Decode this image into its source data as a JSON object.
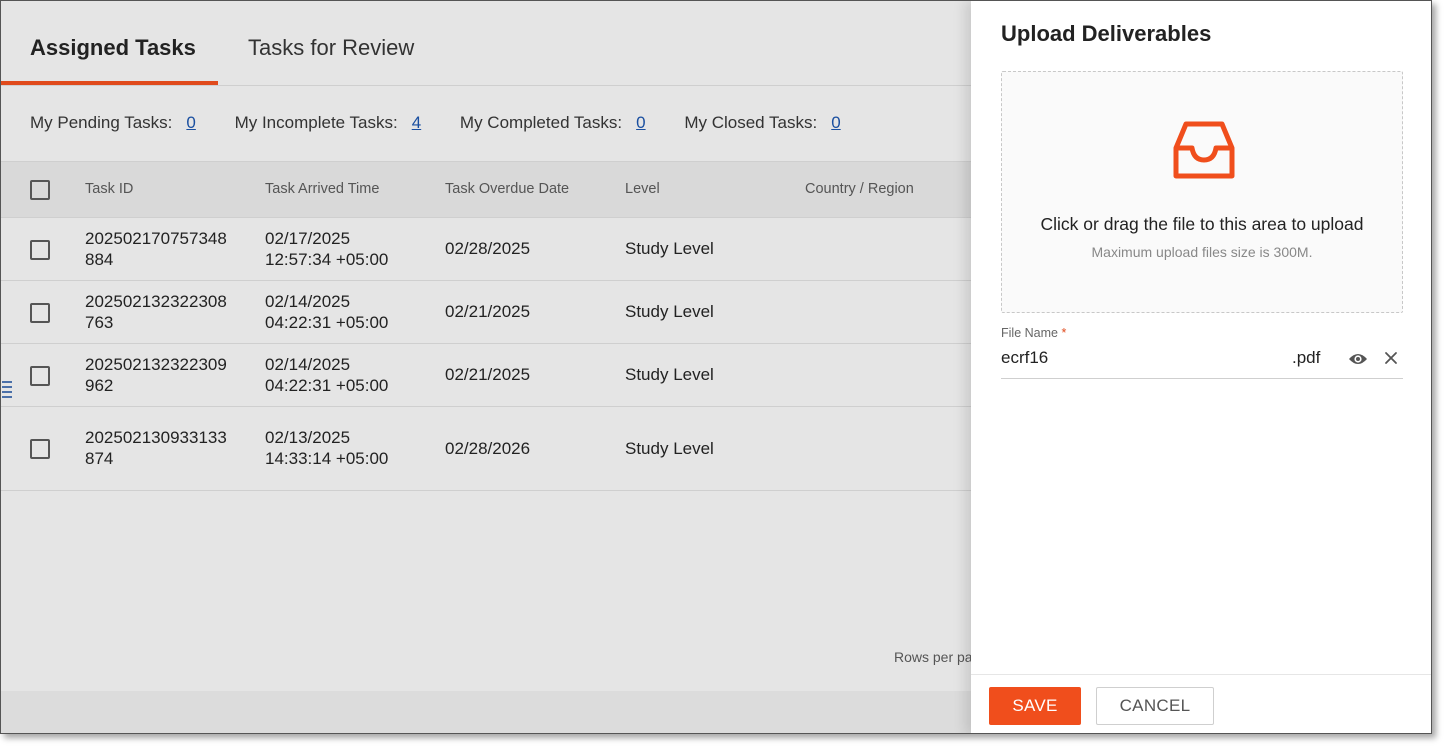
{
  "tabs": [
    {
      "label": "Assigned Tasks",
      "active": true
    },
    {
      "label": "Tasks for Review",
      "active": false
    }
  ],
  "stats": {
    "pending_label": "My Pending Tasks:",
    "pending_value": "0",
    "incomplete_label": "My Incomplete Tasks:",
    "incomplete_value": "4",
    "completed_label": "My Completed Tasks:",
    "completed_value": "0",
    "closed_label": "My Closed Tasks:",
    "closed_value": "0"
  },
  "table": {
    "headers": [
      "Task ID",
      "Task Arrived Time",
      "Task Overdue Date",
      "Level",
      "Country / Region"
    ],
    "rows": [
      {
        "id_line1": "202502170757348",
        "id_line2": "884",
        "arrived_date": "02/17/2025",
        "arrived_time": "12:57:34 +05:00",
        "overdue": "02/28/2025",
        "level": "Study Level"
      },
      {
        "id_line1": "202502132322308",
        "id_line2": "763",
        "arrived_date": "02/14/2025",
        "arrived_time": "04:22:31 +05:00",
        "overdue": "02/21/2025",
        "level": "Study Level"
      },
      {
        "id_line1": "202502132322309",
        "id_line2": "962",
        "arrived_date": "02/14/2025",
        "arrived_time": "04:22:31 +05:00",
        "overdue": "02/21/2025",
        "level": "Study Level"
      },
      {
        "id_line1": "202502130933133",
        "id_line2": "874",
        "arrived_date": "02/13/2025",
        "arrived_time": "14:33:14 +05:00",
        "overdue": "02/28/2026",
        "level": "Study Level"
      }
    ]
  },
  "pagination": {
    "rows_per_page_label": "Rows per pa"
  },
  "drawer": {
    "title": "Upload Deliverables",
    "dropzone": {
      "icon": "inbox-icon",
      "text": "Click or drag the file to this area to upload",
      "hint": "Maximum upload files size is 300M."
    },
    "file_name_label": "File Name",
    "required_mark": "*",
    "file_name_value": "ecrf16",
    "file_extension": ".pdf",
    "preview_icon": "eye-icon",
    "remove_icon": "close-icon",
    "save_label": "SAVE",
    "cancel_label": "CANCEL"
  },
  "colors": {
    "accent": "#f04e1c",
    "tab_underline": "#e04a1c",
    "link": "#1a4fa0",
    "overlay_bg": "#e5e5e5"
  }
}
